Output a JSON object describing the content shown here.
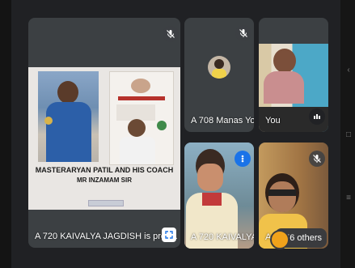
{
  "tiles": {
    "presentation": {
      "label": "A 720 KAIVALYA JAGDISH is pres..."
    },
    "manas": {
      "label": "A 708 Manas Yo..."
    },
    "you": {
      "label": "You"
    },
    "kaivalya": {
      "label": "A 720 KAIVALYA ..."
    },
    "a72": {
      "label": "A 72"
    }
  },
  "slide": {
    "caption_line1": "MASTERARYAN PATIL AND HIS COACH",
    "caption_line2": "MR INZAMAM SIR"
  },
  "others": {
    "label": "56 others"
  },
  "icons": {
    "mute": "mic-off-icon",
    "speaking": "speaking-indicator-icon",
    "present": "fullscreen-icon",
    "audio_levels": "audio-levels-icon"
  },
  "colors": {
    "tile_bg": "#3c4043",
    "screen_bg": "#202124",
    "speaking_blue": "#1a73e8",
    "others_avatar": "#f0a21b"
  }
}
